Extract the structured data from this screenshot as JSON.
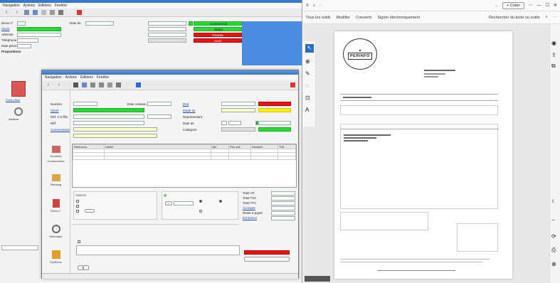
{
  "bg": {
    "menu": [
      "Navigation",
      "Actions",
      "Editions",
      "Fenêtre"
    ],
    "fields": [
      {
        "label": "Devis n°",
        "value": ""
      },
      {
        "label": "Client",
        "value": "",
        "link": true
      },
      {
        "label": "Adresse",
        "value": ""
      },
      {
        "label": "Téléphone",
        "value": "",
        "extra": ""
      },
      {
        "label": "Date pièce",
        "value": ""
      }
    ],
    "date_label": "Date de",
    "date_value": "",
    "status": [
      "Commercial",
      "Statut",
      "Facture",
      "Avoir"
    ],
    "left_nav": [
      "Propositions",
      "Fiche client",
      "Archiver"
    ],
    "bottom_tab": ""
  },
  "fw": {
    "title": "",
    "menu": [
      "Navigation",
      "Actions",
      "Editions",
      "Fenêtre"
    ],
    "sidebar": [
      "Données",
      "Coordonnées",
      "Planning",
      "Devis n°",
      "Historique",
      "Synthèse"
    ],
    "labels": {
      "number": "Numéro",
      "client": "Client",
      "ref": "Réf. 1-5 fille",
      "ref2": "Réf.",
      "comment": "Commentaire",
      "date_pieces": "Date création",
      "delai": "Date de",
      "etat": "État",
      "mode": "Mode de",
      "rep": "Représentant",
      "cat": "Catégorie",
      "conditions": "Conditions"
    },
    "values": {
      "number": "",
      "client": "",
      "date": "",
      "small_date": "",
      "comment1": "",
      "comment2": "",
      "etat": "",
      "mode": "",
      "status_red": "",
      "status_yellow": "",
      "status_green": ""
    },
    "table": {
      "headers": [
        "Référence",
        "Libellé",
        "Qté",
        "Prix unit.",
        "Montant",
        "TVA"
      ],
      "rows": [
        [
          "",
          "",
          "",
          "",
          "",
          ""
        ],
        [
          "",
          "",
          "",
          "",
          "",
          ""
        ],
        [
          "",
          "",
          "",
          "",
          "",
          ""
        ]
      ]
    },
    "options": {
      "section": "Options",
      "cb1": "",
      "cb2": "",
      "cb3": "",
      "btn1": "",
      "btn2": ""
    },
    "payment": {
      "title": "",
      "btn": "",
      "radios": [
        "",
        "",
        ""
      ]
    },
    "totals": {
      "labels": [
        "Total HT",
        "Total TVA",
        "Total TTC",
        "Acompte",
        "Reste à payer",
        "Échéance"
      ],
      "values": [
        "",
        "",
        "",
        "",
        "",
        ""
      ]
    },
    "adresse_fact": "",
    "notes": {
      "person": "",
      "desc": "",
      "type": ""
    },
    "footer": {
      "link": "",
      "btn_a": "",
      "btn_b": "",
      "red": "",
      "right_btn": ""
    },
    "statusbar": [
      "",
      "",
      ""
    ]
  },
  "pdf": {
    "tabs": [
      "Tous les outils",
      "Modifier",
      "Convertir",
      "Signer électroniquement"
    ],
    "search": "Rechercher du texte ou outils",
    "toolbar_title": "Créer",
    "logo": "PERINFO",
    "date": "",
    "footer_page": ""
  }
}
